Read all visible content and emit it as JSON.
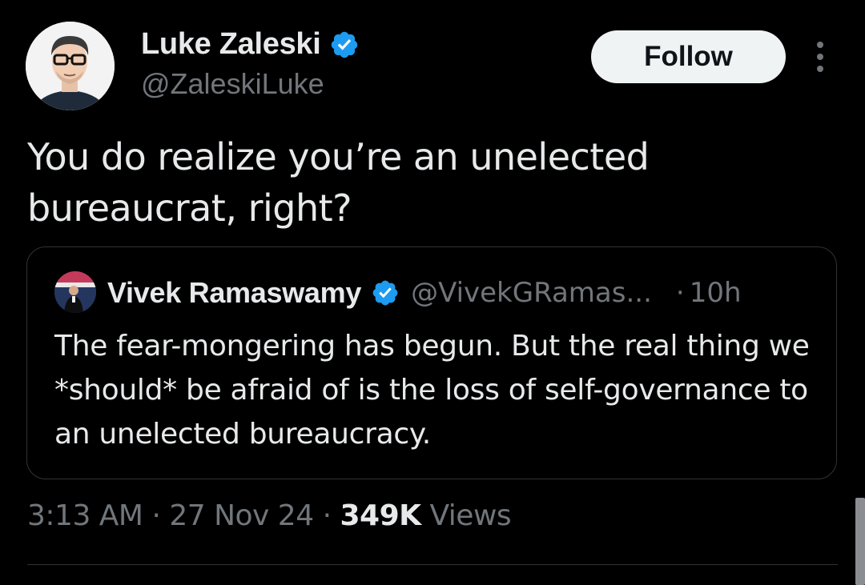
{
  "author": {
    "display_name": "Luke Zaleski",
    "handle": "@ZaleskiLuke",
    "verified": true
  },
  "actions": {
    "follow_label": "Follow",
    "more_icon": "more-vertical-icon"
  },
  "tweet": {
    "text": "You do realize you’re an unelected bureaucrat, right?"
  },
  "quoted_tweet": {
    "display_name": "Vivek Ramaswamy",
    "handle": "@VivekGRamas...",
    "separator": "·",
    "time": "10h",
    "verified": true,
    "text": "The fear-mongering has begun. But the real thing we *should* be afraid of is the loss of self-governance to an unelected bureaucracy."
  },
  "meta": {
    "time": "3:13 AM",
    "separator": "·",
    "date": "27 Nov 24",
    "views_count": "349K",
    "views_label": "Views"
  },
  "colors": {
    "background": "#000000",
    "primary_text": "#e7e9ea",
    "secondary_text": "#71767b",
    "verified_blue": "#1d9bf0",
    "border": "#2f3336",
    "follow_button_bg": "#eff3f4"
  }
}
